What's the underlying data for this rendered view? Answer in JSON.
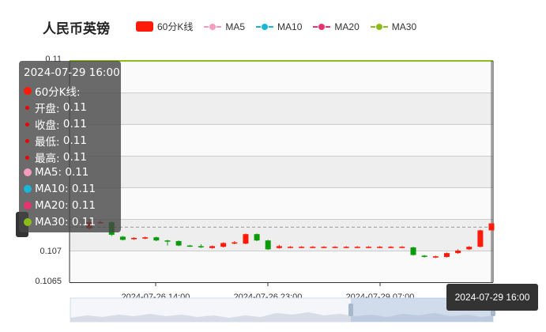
{
  "chart_data": {
    "type": "candlestick",
    "title": "人民币英镑",
    "legend": [
      {
        "name": "60分K线",
        "color": "#ff1a0a",
        "style": "rect"
      },
      {
        "name": "MA5",
        "color": "#f59bbd",
        "style": "line"
      },
      {
        "name": "MA10",
        "color": "#1ab6d8",
        "style": "line"
      },
      {
        "name": "MA20",
        "color": "#e8336e",
        "style": "line"
      },
      {
        "name": "MA30",
        "color": "#8bbd1a",
        "style": "line"
      }
    ],
    "y_ticks": [
      "0.11",
      "0.107",
      "0.1065"
    ],
    "ylim": [
      0.1065,
      0.11
    ],
    "x_ticks": [
      "2024-07-26 14:00",
      "2024-07-26 23:00",
      "2024-07-29 07:00"
    ],
    "candles": [
      {
        "o": 0.10735,
        "c": 0.10745,
        "h": 0.1075,
        "l": 0.10733
      },
      {
        "o": 0.10745,
        "c": 0.10745,
        "h": 0.10747,
        "l": 0.10744
      },
      {
        "o": 0.10745,
        "c": 0.10725,
        "h": 0.10746,
        "l": 0.10723
      },
      {
        "o": 0.10722,
        "c": 0.10717,
        "h": 0.10723,
        "l": 0.10716
      },
      {
        "o": 0.10718,
        "c": 0.1072,
        "h": 0.10721,
        "l": 0.10717
      },
      {
        "o": 0.10719,
        "c": 0.10721,
        "h": 0.10722,
        "l": 0.10718
      },
      {
        "o": 0.10721,
        "c": 0.10716,
        "h": 0.10722,
        "l": 0.10715
      },
      {
        "o": 0.10716,
        "c": 0.10715,
        "h": 0.10717,
        "l": 0.10708
      },
      {
        "o": 0.10715,
        "c": 0.10708,
        "h": 0.10716,
        "l": 0.10707
      },
      {
        "o": 0.10708,
        "c": 0.10707,
        "h": 0.10709,
        "l": 0.10706
      },
      {
        "o": 0.10707,
        "c": 0.10706,
        "h": 0.1071,
        "l": 0.10704
      },
      {
        "o": 0.10704,
        "c": 0.10707,
        "h": 0.10708,
        "l": 0.10703
      },
      {
        "o": 0.10706,
        "c": 0.10712,
        "h": 0.10713,
        "l": 0.10705
      },
      {
        "o": 0.10711,
        "c": 0.10713,
        "h": 0.10715,
        "l": 0.1071
      },
      {
        "o": 0.10711,
        "c": 0.10726,
        "h": 0.10727,
        "l": 0.1071
      },
      {
        "o": 0.10726,
        "c": 0.10716,
        "h": 0.10727,
        "l": 0.10715
      },
      {
        "o": 0.10716,
        "c": 0.10702,
        "h": 0.10717,
        "l": 0.10701
      },
      {
        "o": 0.10704,
        "c": 0.10707,
        "h": 0.10709,
        "l": 0.10703
      },
      {
        "o": 0.10705,
        "c": 0.10706,
        "h": 0.10707,
        "l": 0.10704
      },
      {
        "o": 0.10705,
        "c": 0.10706,
        "h": 0.10707,
        "l": 0.10704
      },
      {
        "o": 0.10705,
        "c": 0.10706,
        "h": 0.10707,
        "l": 0.10704
      },
      {
        "o": 0.10705,
        "c": 0.10706,
        "h": 0.10707,
        "l": 0.10704
      },
      {
        "o": 0.10705,
        "c": 0.10706,
        "h": 0.10707,
        "l": 0.10704
      },
      {
        "o": 0.10705,
        "c": 0.10706,
        "h": 0.10707,
        "l": 0.10704
      },
      {
        "o": 0.10705,
        "c": 0.10706,
        "h": 0.10707,
        "l": 0.10704
      },
      {
        "o": 0.10705,
        "c": 0.10706,
        "h": 0.10707,
        "l": 0.10704
      },
      {
        "o": 0.10705,
        "c": 0.10706,
        "h": 0.10707,
        "l": 0.10704
      },
      {
        "o": 0.10705,
        "c": 0.10706,
        "h": 0.10707,
        "l": 0.10704
      },
      {
        "o": 0.10705,
        "c": 0.10706,
        "h": 0.10707,
        "l": 0.10704
      },
      {
        "o": 0.10705,
        "c": 0.10693,
        "h": 0.10706,
        "l": 0.10692
      },
      {
        "o": 0.10692,
        "c": 0.1069,
        "h": 0.10693,
        "l": 0.10689
      },
      {
        "o": 0.10689,
        "c": 0.10691,
        "h": 0.10692,
        "l": 0.10688
      },
      {
        "o": 0.1069,
        "c": 0.10696,
        "h": 0.10697,
        "l": 0.10689
      },
      {
        "o": 0.10696,
        "c": 0.107,
        "h": 0.10702,
        "l": 0.10695
      },
      {
        "o": 0.10702,
        "c": 0.10706,
        "h": 0.10707,
        "l": 0.10701
      },
      {
        "o": 0.10706,
        "c": 0.10732,
        "h": 0.10733,
        "l": 0.10705
      },
      {
        "o": 0.10732,
        "c": 0.10743,
        "h": 0.10744,
        "l": 0.10731
      }
    ],
    "last_price": 0.10737,
    "grid": true
  },
  "tooltip": {
    "time": "2024-07-29 16:00",
    "series_label": "60分K线:",
    "rows": [
      {
        "label": "开盘:",
        "value": "0.11"
      },
      {
        "label": "收盘:",
        "value": "0.11"
      },
      {
        "label": "最低:",
        "value": "0.11"
      },
      {
        "label": "最高:",
        "value": "0.11"
      }
    ],
    "ma": [
      {
        "label": "MA5:",
        "value": "0.11",
        "color": "#f59bbd"
      },
      {
        "label": "MA10:",
        "value": "0.11",
        "color": "#1ab6d8"
      },
      {
        "label": "MA20:",
        "value": "0.11",
        "color": "#e8336e"
      },
      {
        "label": "MA30:",
        "value": "0.11",
        "color": "#8bbd1a"
      }
    ]
  },
  "axis_pointer_time": "2024-07-29 16:00",
  "colors": {
    "up": "#ff1a0a",
    "down": "#0a9b0a",
    "ma30": "#8bbd1a"
  }
}
